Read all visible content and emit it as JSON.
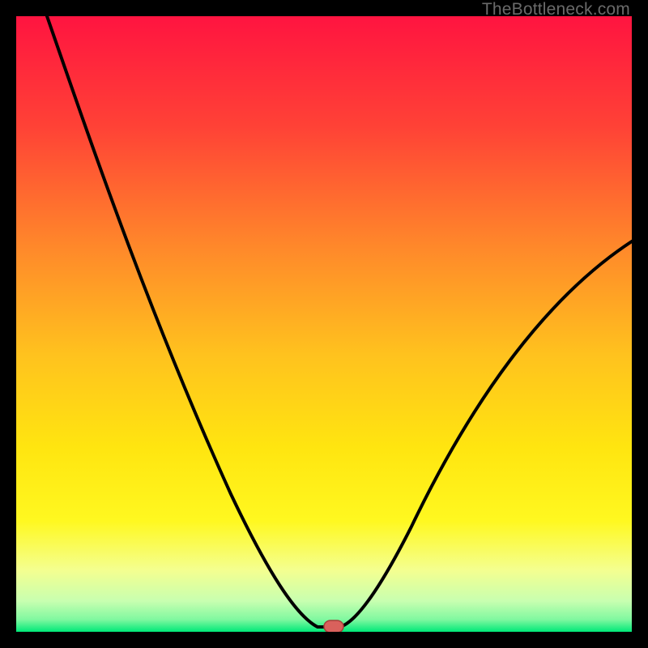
{
  "watermark": "TheBottleneck.com",
  "colors": {
    "gradient_top": "#ff1440",
    "gradient_mid_upper": "#ff7a30",
    "gradient_mid": "#ffd800",
    "gradient_mid_lower": "#fff060",
    "gradient_lower": "#e6ffb0",
    "gradient_bottom": "#00e878",
    "curve": "#000000",
    "marker_fill": "#d9615c",
    "marker_stroke": "#a83e3a",
    "frame": "#000000"
  },
  "chart_data": {
    "type": "line",
    "title": "",
    "xlabel": "",
    "ylabel": "",
    "xlim": [
      0,
      100
    ],
    "ylim": [
      0,
      100
    ],
    "series": [
      {
        "name": "bottleneck-curve",
        "x": [
          5,
          10,
          15,
          20,
          25,
          30,
          35,
          40,
          45,
          47,
          49,
          50,
          51,
          52,
          53,
          55,
          60,
          65,
          70,
          75,
          80,
          85,
          90,
          95,
          100
        ],
        "values": [
          100,
          88,
          76,
          65,
          54,
          43,
          33,
          23,
          12,
          6,
          2,
          0.5,
          0.5,
          0.5,
          1.5,
          4,
          12,
          20,
          28,
          35,
          42,
          48,
          54,
          59,
          63
        ]
      }
    ],
    "marker": {
      "x": 51,
      "y": 0.5
    },
    "flat_minimum": {
      "x_start": 49,
      "x_end": 52,
      "y": 0.5
    },
    "legend_position": "none",
    "grid": false
  }
}
